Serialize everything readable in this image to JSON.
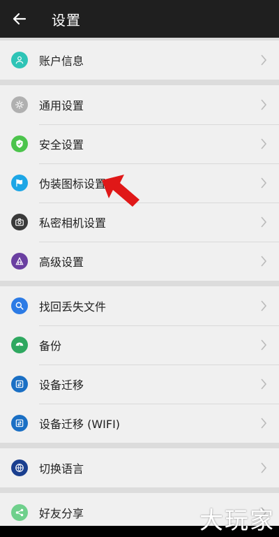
{
  "header": {
    "title": "设置",
    "back_icon": "arrow-left-icon"
  },
  "groups": [
    [
      {
        "label": "账户信息",
        "icon": "person-icon",
        "color": "#2ec4b6"
      }
    ],
    [
      {
        "label": "通用设置",
        "icon": "gear-icon",
        "color": "#b0b0b0"
      },
      {
        "label": "安全设置",
        "icon": "shield-icon",
        "color": "#4cc44c"
      },
      {
        "label": "伪装图标设置",
        "icon": "flag-icon",
        "color": "#1da6e6"
      },
      {
        "label": "私密相机设置",
        "icon": "camera-icon",
        "color": "#3a3a3a"
      },
      {
        "label": "高级设置",
        "icon": "advanced-icon",
        "color": "#6a3fa1"
      }
    ],
    [
      {
        "label": "找回丢失文件",
        "icon": "search-icon",
        "color": "#2c7be5"
      },
      {
        "label": "备份",
        "icon": "backup-icon",
        "color": "#2fa860"
      },
      {
        "label": "设备迁移",
        "icon": "migrate-icon",
        "color": "#1a6fc4"
      },
      {
        "label": "设备迁移 (WIFI)",
        "icon": "migrate-icon",
        "color": "#1a6fc4"
      }
    ],
    [
      {
        "label": "切换语言",
        "icon": "globe-icon",
        "color": "#1a3f8f"
      }
    ],
    [
      {
        "label": "好友分享",
        "icon": "share-icon",
        "color": "#6fd08c"
      }
    ]
  ],
  "watermark": "大玩家"
}
